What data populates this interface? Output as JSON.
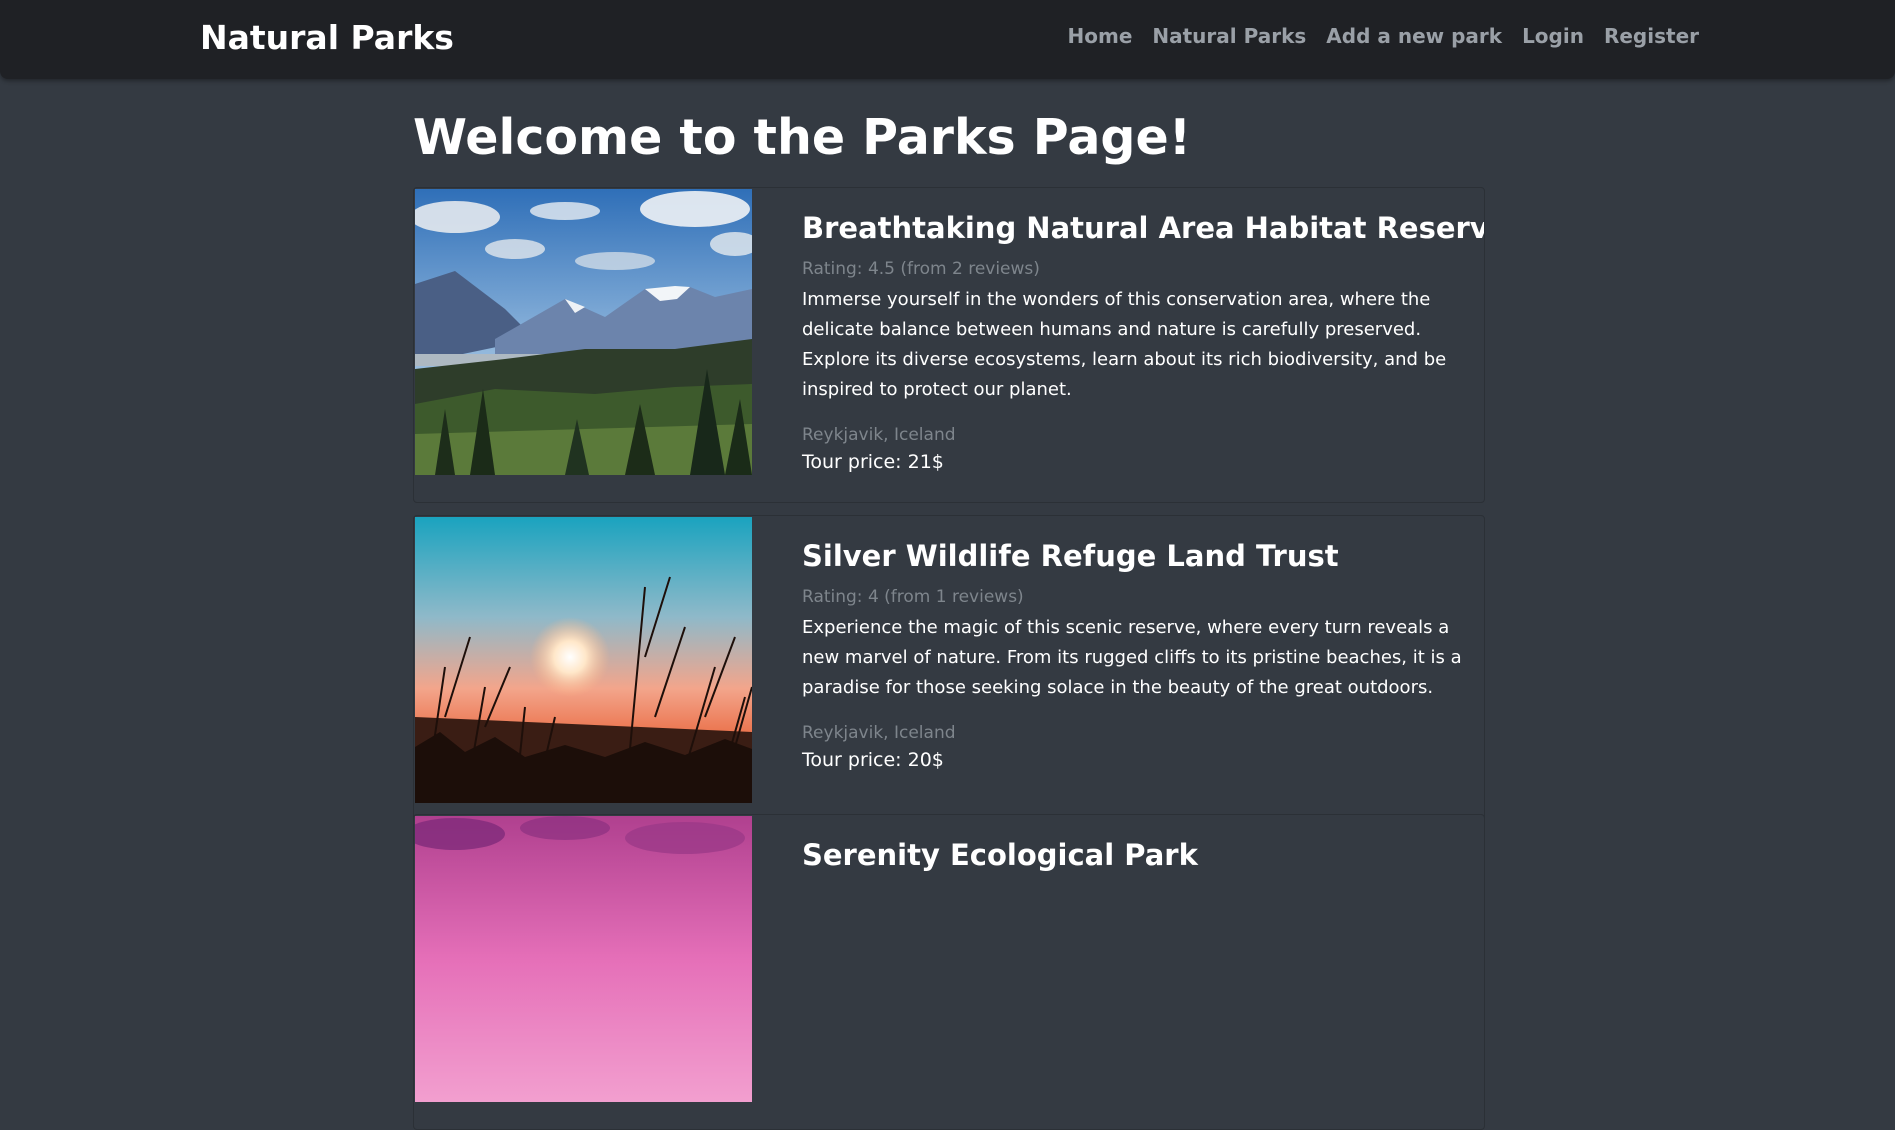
{
  "navbar": {
    "brand": "Natural Parks",
    "links": [
      {
        "label": "Home"
      },
      {
        "label": "Natural Parks"
      },
      {
        "label": "Add a new park"
      },
      {
        "label": "Login"
      },
      {
        "label": "Register"
      }
    ]
  },
  "main": {
    "title": "Welcome to the Parks Page!",
    "parks": [
      {
        "title": "Breathtaking Natural Area Habitat Reserve",
        "rating": "Rating: 4.5 (from 2 reviews)",
        "description": "Immerse yourself in the wonders of this conservation area, where the delicate balance between humans and nature is carefully preserved. Explore its diverse ecosystems, learn about its rich biodiversity, and be inspired to protect our planet.",
        "location": "Reykjavik, Iceland",
        "price": "Tour price: 21$"
      },
      {
        "title": "Silver Wildlife Refuge Land Trust",
        "rating": "Rating: 4 (from 1 reviews)",
        "description": "Experience the magic of this scenic reserve, where every turn reveals a new marvel of nature. From its rugged cliffs to its pristine beaches, it is a paradise for those seeking solace in the beauty of the great outdoors.",
        "location": "Reykjavik, Iceland",
        "price": "Tour price: 20$"
      },
      {
        "title": "Serenity Ecological Park",
        "rating": "",
        "description": "",
        "location": "",
        "price": ""
      }
    ]
  },
  "colors": {
    "background": "#343a42",
    "navbar": "#1f2125",
    "nav_link": "#9aa0a7",
    "muted_text": "#7e858c"
  }
}
